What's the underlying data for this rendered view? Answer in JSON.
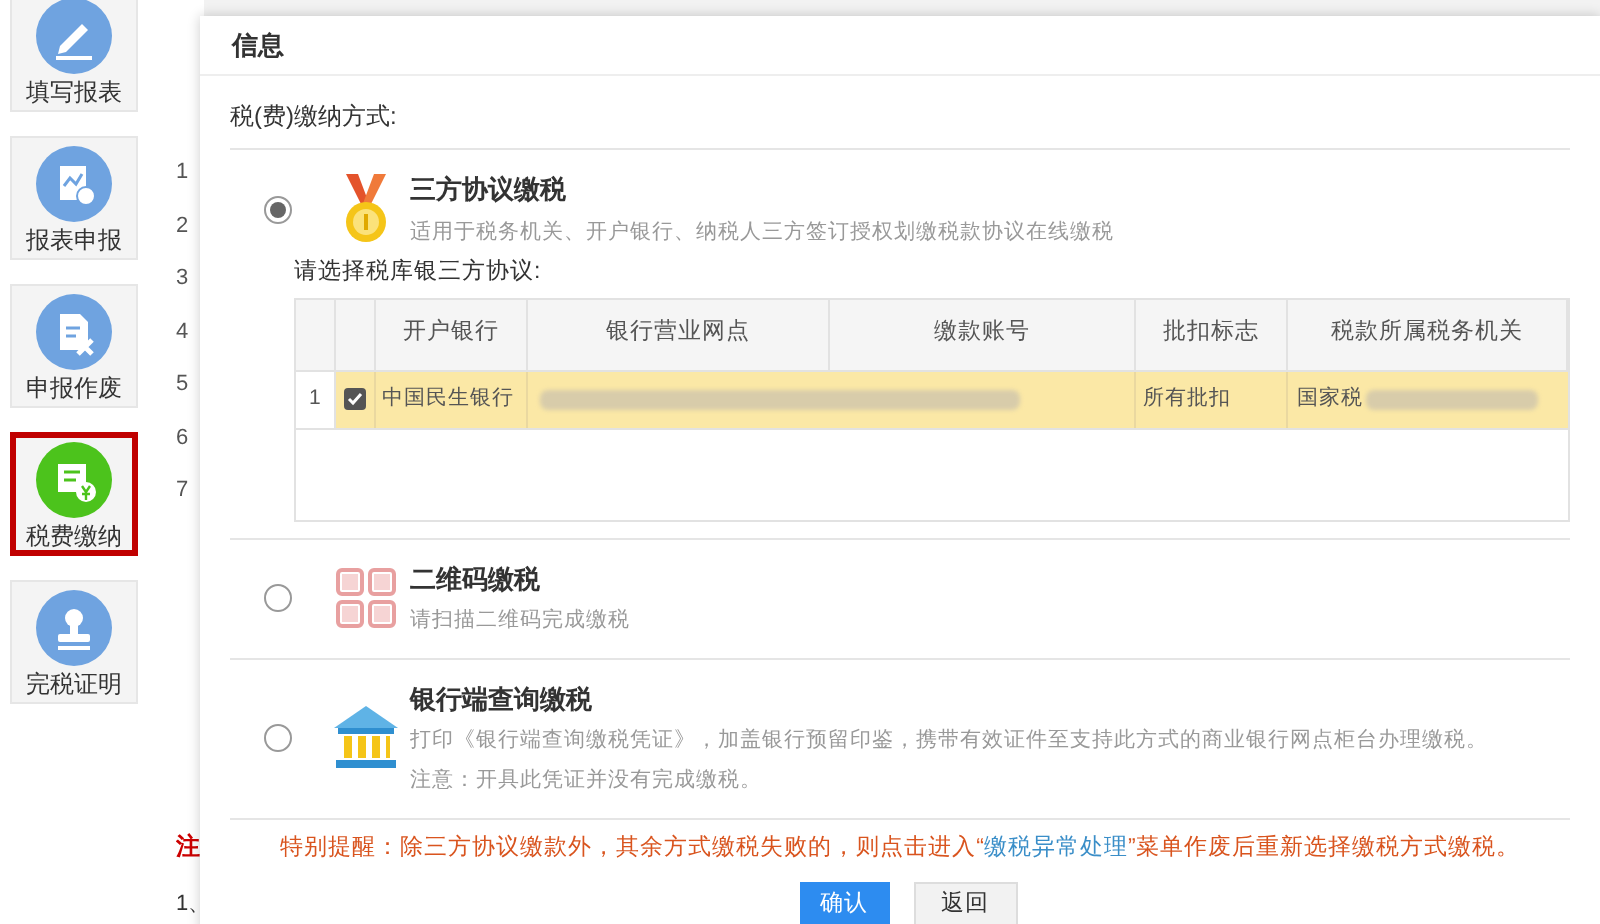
{
  "sidebar": {
    "items": [
      {
        "label": "填写报表",
        "kind": "pencil",
        "selected": false
      },
      {
        "label": "报表申报",
        "kind": "report",
        "selected": false
      },
      {
        "label": "申报作废",
        "kind": "void",
        "selected": false
      },
      {
        "label": "税费缴纳",
        "kind": "pay",
        "selected": true
      },
      {
        "label": "完税证明",
        "kind": "stamp",
        "selected": false
      }
    ]
  },
  "background_page": {
    "row_numbers": [
      "1",
      "2",
      "3",
      "4",
      "5",
      "6",
      "7"
    ],
    "note_label": "注",
    "note_line": "1、"
  },
  "dialog": {
    "title": "信息",
    "section_label": "税(费)缴纳方式:",
    "options": [
      {
        "kind": "agreement",
        "title": "三方协议缴税",
        "description": "适用于税务机关、开户银行、纳税人三方签订授权划缴税款协议在线缴税",
        "selected": true,
        "table_label": "请选择税库银三方协议:",
        "table": {
          "columns": [
            "开户银行",
            "银行营业网点",
            "缴款账号",
            "批扣标志",
            "税款所属税务机关"
          ],
          "rows": [
            {
              "index": "1",
              "checked": true,
              "selected": true,
              "bank": "中国民生银行",
              "deduction": "所有批扣",
              "authority": "国家税"
            }
          ]
        }
      },
      {
        "kind": "qrcode",
        "title": "二维码缴税",
        "description": "请扫描二维码完成缴税",
        "selected": false
      },
      {
        "kind": "bank",
        "title": "银行端查询缴税",
        "description": "打印《银行端查询缴税凭证》，加盖银行预留印鉴，携带有效证件至支持此方式的商业银行网点柜台办理缴税。",
        "note": "注意：开具此凭证并没有完成缴税。",
        "selected": false
      }
    ],
    "warning": {
      "before": "特别提醒：除三方协议缴款外，其余方式缴税失败的，则点击进入“",
      "link": "缴税异常处理",
      "after": "”菜单作废后重新选择缴税方式缴税。"
    },
    "buttons": [
      {
        "label": "确认",
        "kind": "primary"
      },
      {
        "label": "返回",
        "kind": "secondary"
      }
    ]
  }
}
